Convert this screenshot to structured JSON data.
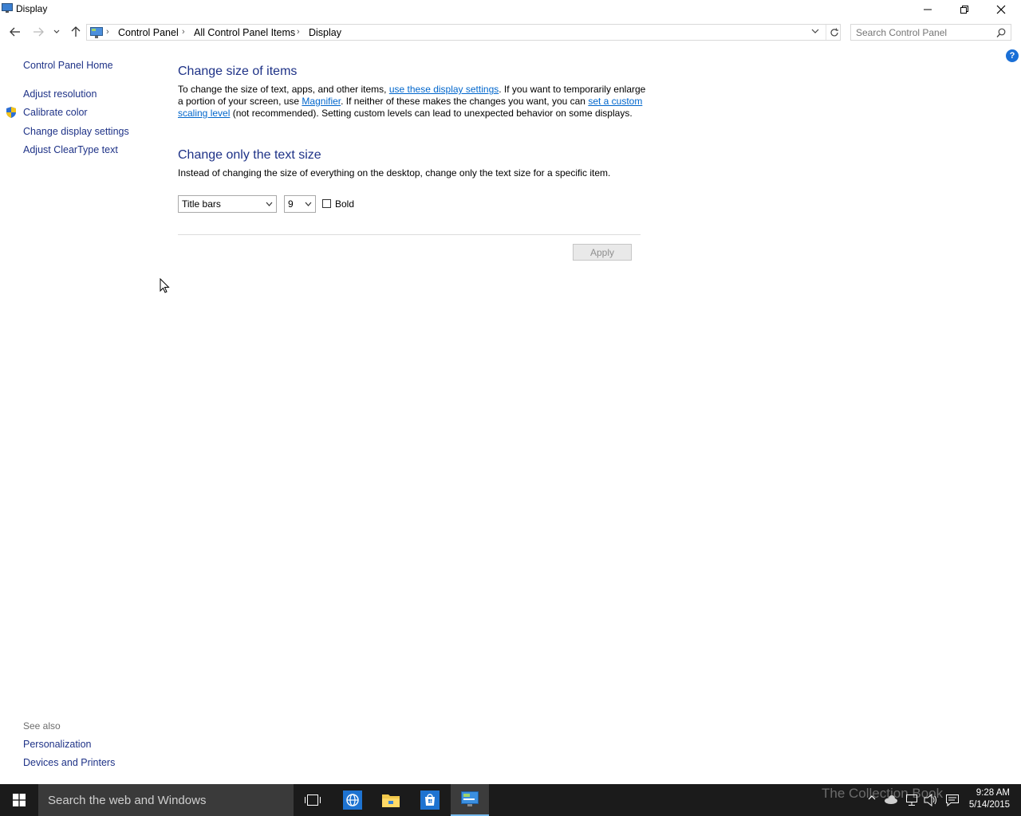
{
  "window": {
    "title": "Display"
  },
  "breadcrumb": [
    "Control Panel",
    "All Control Panel Items",
    "Display"
  ],
  "search": {
    "placeholder": "Search Control Panel"
  },
  "left_pane": {
    "home": "Control Panel Home",
    "links": [
      "Adjust resolution",
      "Calibrate color",
      "Change display settings",
      "Adjust ClearType text"
    ],
    "see_also_title": "See also",
    "see_also": [
      "Personalization",
      "Devices and Printers"
    ]
  },
  "main": {
    "section1": {
      "title": "Change size of items",
      "p1": "To change the size of text, apps, and other items, ",
      "link1": "use these display settings",
      "p2": ".  If you want to temporarily enlarge a portion of your screen, use ",
      "link2": "Magnifier",
      "p3": ".  If neither of these makes the changes you want, you can ",
      "link3": "set a custom scaling level",
      "p4": " (not recommended).  Setting custom levels can lead to unexpected behavior on some displays."
    },
    "section2": {
      "title": "Change only the text size",
      "desc": "Instead of changing the size of everything on the desktop, change only the text size for a specific item.",
      "item_select": "Title bars",
      "size_select": "9",
      "bold_label": "Bold",
      "bold_checked": false
    },
    "apply_label": "Apply",
    "help_label": "?"
  },
  "taskbar": {
    "search_text": "Search the web and Windows",
    "time": "9:28 AM",
    "date": "5/14/2015",
    "watermark": "The Collection Book"
  },
  "colors": {
    "heading": "#1e3287",
    "link": "#0066cc",
    "taskbar": "#1b1b1b"
  }
}
